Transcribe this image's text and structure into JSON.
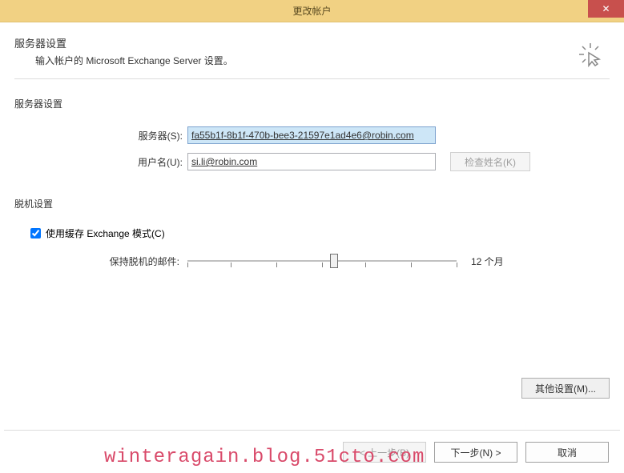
{
  "window": {
    "title": "更改帐户"
  },
  "header": {
    "title": "服务器设置",
    "subtitle": "输入帐户的 Microsoft Exchange Server 设置。"
  },
  "sections": {
    "server_settings_label": "服务器设置",
    "offline_settings_label": "脱机设置"
  },
  "fields": {
    "server": {
      "label": "服务器(S):",
      "value": "fa55b1f-8b1f-470b-bee3-21597e1ad4e6@robin.com"
    },
    "username": {
      "label": "用户名(U):",
      "value": "si.li@robin.com"
    },
    "check_name_btn": "检查姓名(K)"
  },
  "offline": {
    "cached_mode_label": "使用缓存 Exchange 模式(C)",
    "cached_mode_checked": true,
    "keep_offline_label": "保持脱机的邮件:",
    "slider_value_text": "12 个月"
  },
  "buttons": {
    "more_settings": "其他设置(M)...",
    "back": "< 上一步(B)",
    "next": "下一步(N) >",
    "cancel": "取消"
  },
  "watermark": "winteragain.blog.51cto.com"
}
